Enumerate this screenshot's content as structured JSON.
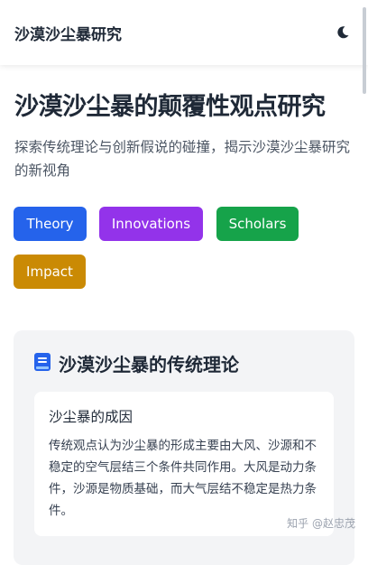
{
  "header": {
    "brand": "沙漠沙尘暴研究",
    "theme_icon": "moon-icon"
  },
  "hero": {
    "title": "沙漠沙尘暴的颠覆性观点研究",
    "subtitle": "探索传统理论与创新假说的碰撞，揭示沙漠沙尘暴研究的新视角"
  },
  "tags": [
    {
      "label": "Theory",
      "color": "#2563eb"
    },
    {
      "label": "Innovations",
      "color": "#9333ea"
    },
    {
      "label": "Scholars",
      "color": "#16a34a"
    },
    {
      "label": "Impact",
      "color": "#ca8a04"
    }
  ],
  "section": {
    "icon": "book-icon",
    "title": "沙漠沙尘暴的传统理论",
    "card": {
      "title": "沙尘暴的成因",
      "body": "传统观点认为沙尘暴的形成主要由大风、沙源和不稳定的空气层结三个条件共同作用。大风是动力条件，沙源是物质基础，而大气层结不稳定是热力条件。"
    }
  },
  "watermark": "知乎 @赵忠茂"
}
